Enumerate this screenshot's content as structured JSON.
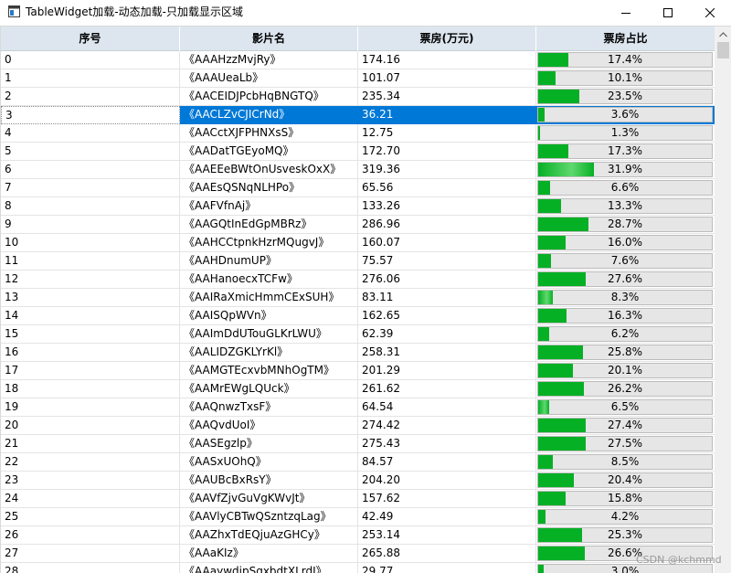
{
  "window": {
    "title": "TableWidget加载-动态加载-只加载显示区域",
    "icons": {
      "app": "app-window-icon",
      "minimize": "minimize-icon",
      "maximize": "maximize-icon",
      "close": "close-icon"
    }
  },
  "table": {
    "columns": [
      "序号",
      "影片名",
      "票房(万元)",
      "票房占比"
    ],
    "selected_index": 3,
    "bar_color": "#06b025",
    "selection_color": "#0078d7",
    "header_color": "#dde6ef",
    "rows": [
      {
        "index": "0",
        "name": "《AAAHzzMvjRy》",
        "box": "174.16",
        "pct_label": "17.4%",
        "pct": 17.4
      },
      {
        "index": "1",
        "name": "《AAAUeaLb》",
        "box": "101.07",
        "pct_label": "10.1%",
        "pct": 10.1
      },
      {
        "index": "2",
        "name": "《AACEIDJPcbHqBNGTQ》",
        "box": "235.34",
        "pct_label": "23.5%",
        "pct": 23.5
      },
      {
        "index": "3",
        "name": "《AACLZvCJICrNd》",
        "box": "36.21",
        "pct_label": "3.6%",
        "pct": 3.6
      },
      {
        "index": "4",
        "name": "《AACctXJFPHNXsS》",
        "box": "12.75",
        "pct_label": "1.3%",
        "pct": 1.3
      },
      {
        "index": "5",
        "name": "《AADatTGEyoMQ》",
        "box": "172.70",
        "pct_label": "17.3%",
        "pct": 17.3
      },
      {
        "index": "6",
        "name": "《AAEEeBWtOnUsveskOxX》",
        "box": "319.36",
        "pct_label": "31.9%",
        "pct": 31.9
      },
      {
        "index": "7",
        "name": "《AAEsQSNqNLHPo》",
        "box": "65.56",
        "pct_label": "6.6%",
        "pct": 6.6
      },
      {
        "index": "8",
        "name": "《AAFVfnAj》",
        "box": "133.26",
        "pct_label": "13.3%",
        "pct": 13.3
      },
      {
        "index": "9",
        "name": "《AAGQtInEdGpMBRz》",
        "box": "286.96",
        "pct_label": "28.7%",
        "pct": 28.7
      },
      {
        "index": "10",
        "name": "《AAHCCtpnkHzrMQugvJ》",
        "box": "160.07",
        "pct_label": "16.0%",
        "pct": 16.0
      },
      {
        "index": "11",
        "name": "《AAHDnumUP》",
        "box": "75.57",
        "pct_label": "7.6%",
        "pct": 7.6
      },
      {
        "index": "12",
        "name": "《AAHanoecxTCFw》",
        "box": "276.06",
        "pct_label": "27.6%",
        "pct": 27.6
      },
      {
        "index": "13",
        "name": "《AAIRaXmicHmmCExSUH》",
        "box": "83.11",
        "pct_label": "8.3%",
        "pct": 8.3
      },
      {
        "index": "14",
        "name": "《AAISQpWVn》",
        "box": "162.65",
        "pct_label": "16.3%",
        "pct": 16.3
      },
      {
        "index": "15",
        "name": "《AAImDdUTouGLKrLWU》",
        "box": "62.39",
        "pct_label": "6.2%",
        "pct": 6.2
      },
      {
        "index": "16",
        "name": "《AALIDZGKLYrKl》",
        "box": "258.31",
        "pct_label": "25.8%",
        "pct": 25.8
      },
      {
        "index": "17",
        "name": "《AAMGTEcxvbMNhOgTM》",
        "box": "201.29",
        "pct_label": "20.1%",
        "pct": 20.1
      },
      {
        "index": "18",
        "name": "《AAMrEWgLQUck》",
        "box": "261.62",
        "pct_label": "26.2%",
        "pct": 26.2
      },
      {
        "index": "19",
        "name": "《AAQnwzTxsF》",
        "box": "64.54",
        "pct_label": "6.5%",
        "pct": 6.5
      },
      {
        "index": "20",
        "name": "《AAQvdUoI》",
        "box": "274.42",
        "pct_label": "27.4%",
        "pct": 27.4
      },
      {
        "index": "21",
        "name": "《AASEgzlp》",
        "box": "275.43",
        "pct_label": "27.5%",
        "pct": 27.5
      },
      {
        "index": "22",
        "name": "《AASxUOhQ》",
        "box": "84.57",
        "pct_label": "8.5%",
        "pct": 8.5
      },
      {
        "index": "23",
        "name": "《AAUBcBxRsY》",
        "box": "204.20",
        "pct_label": "20.4%",
        "pct": 20.4
      },
      {
        "index": "24",
        "name": "《AAVfZjvGuVgKWvJt》",
        "box": "157.62",
        "pct_label": "15.8%",
        "pct": 15.8
      },
      {
        "index": "25",
        "name": "《AAVlyCBTwQSzntzqLag》",
        "box": "42.49",
        "pct_label": "4.2%",
        "pct": 4.2
      },
      {
        "index": "26",
        "name": "《AAZhxTdEQjuAzGHCy》",
        "box": "253.14",
        "pct_label": "25.3%",
        "pct": 25.3
      },
      {
        "index": "27",
        "name": "《AAaKIz》",
        "box": "265.88",
        "pct_label": "26.6%",
        "pct": 26.6
      },
      {
        "index": "28",
        "name": "《AAaywdipSqxbdtXLrdJ》",
        "box": "29.77",
        "pct_label": "3.0%",
        "pct": 3.0
      }
    ]
  },
  "watermark": "CSDN @kchmmd"
}
